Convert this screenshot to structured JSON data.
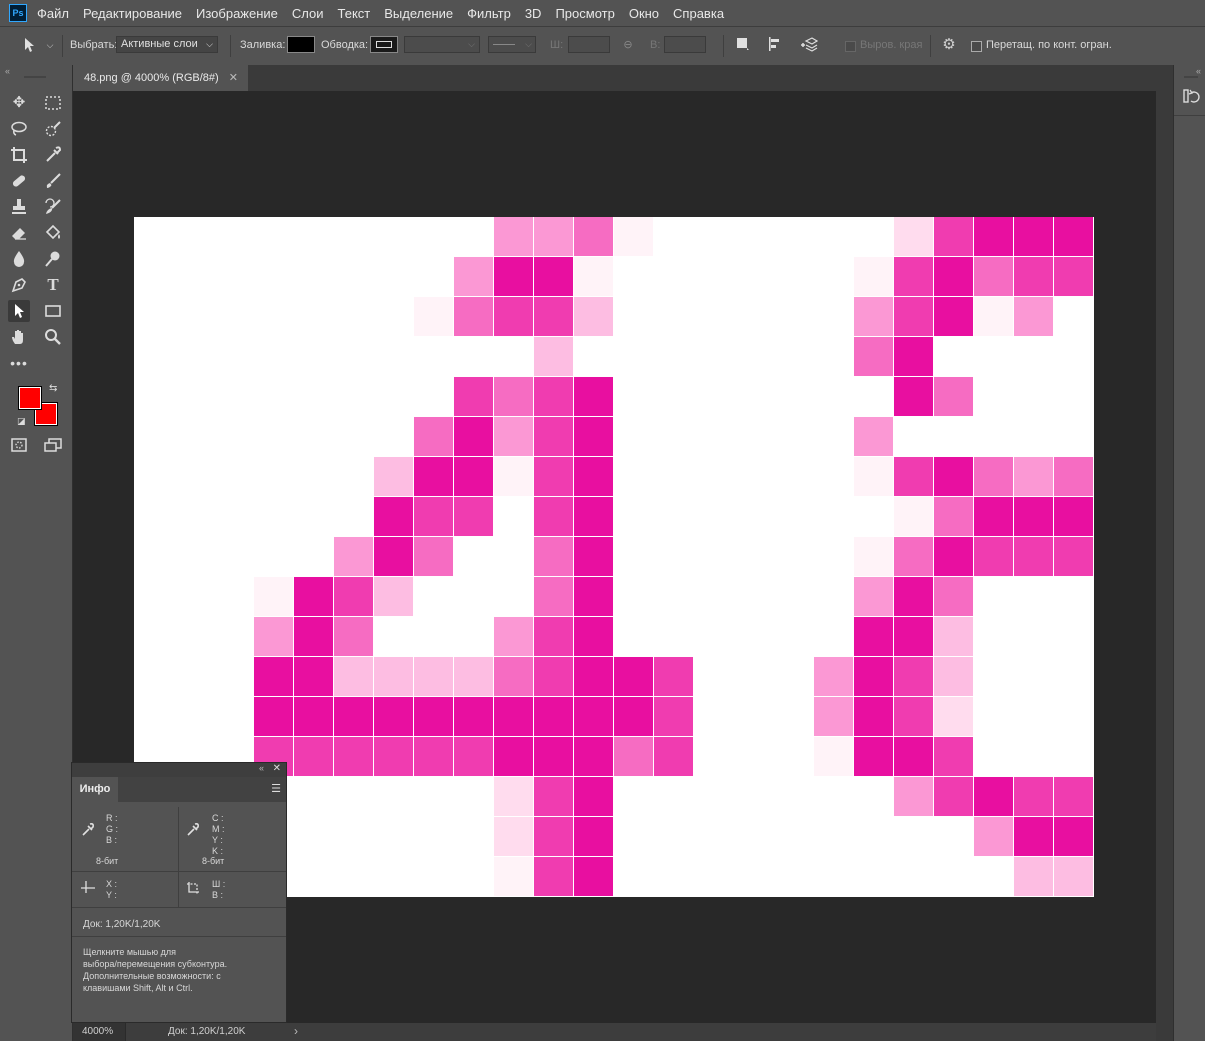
{
  "app": {
    "logo": "Ps"
  },
  "menu": [
    "Файл",
    "Редактирование",
    "Изображение",
    "Слои",
    "Текст",
    "Выделение",
    "Фильтр",
    "3D",
    "Просмотр",
    "Окно",
    "Справка"
  ],
  "options": {
    "select_label": "Выбрать:",
    "select_value": "Активные слои",
    "fill_label": "Заливка:",
    "stroke_label": "Обводка:",
    "w_label": "Ш:",
    "h_label": "В:",
    "align_edges_label": "Выров. края",
    "constrain_label": "Перетащ. по конт. огран."
  },
  "document": {
    "tab_title": "48.png @ 4000% (RGB/8#)"
  },
  "status": {
    "zoom": "4000%",
    "doc": "Док: 1,20K/1,20K"
  },
  "colors": {
    "foreground": "#ff0000",
    "background": "#ff0000"
  },
  "info_panel": {
    "title": "Инфо",
    "rgb": [
      "R :",
      "G :",
      "B :"
    ],
    "cmyk": [
      "C :",
      "M :",
      "Y :",
      "K :"
    ],
    "bit_left": "8-бит",
    "bit_right": "8-бит",
    "xy": [
      "X :",
      "Y :"
    ],
    "wh": [
      "Ш :",
      "В :"
    ],
    "doc": "Док: 1,20K/1,20K",
    "hint": [
      "Щелкните мышью для",
      "выбора/перемещения субконтура.",
      "Дополнительные возможности: с",
      "клавишами Shift, Alt и Ctrl."
    ]
  },
  "image_pixels": {
    "cols": 24,
    "rows": 17,
    "palette": {
      "1": "#fff3f8",
      "2": "#ffdcee",
      "3": "#fdbde2",
      "4": "#fb98d4",
      "5": "#f66cc2",
      "6": "#f03cb0",
      "7": "#e80fa0"
    },
    "grid": [
      "000000000445100000026777740000",
      "000000004771000000167566770400",
      "000000015663000000467140177240",
      "000000000030000000570000673000",
      "000000006567000000075000654000",
      "000000057467000000400000071000",
      "000000377167000000167545571000",
      "000000766067000000015777651000",
      "000004750057000000157666772000",
      "000176300057000000475000267410",
      "000475000467000000773000477620",
      "000773333567760004763000477500",
      "000777777777760004762000477600",
      "000666666777560001776000277400",
      "000000000267000000046766576650",
      "000000000267000000000477777620",
      "000000000167000000000033454320"
    ]
  }
}
